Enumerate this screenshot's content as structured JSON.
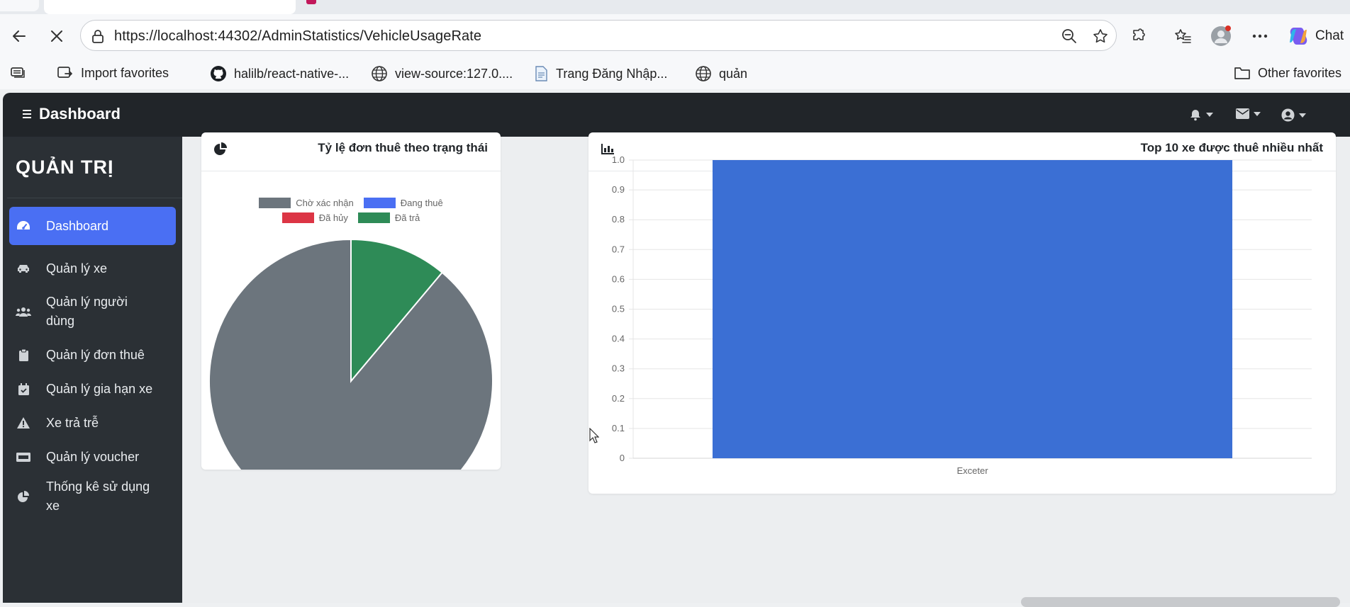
{
  "browser": {
    "url": "https://localhost:44302/AdminStatistics/VehicleUsageRate",
    "copilot_label": "Chat",
    "favorites": [
      {
        "label": "Import favorites",
        "icon": "import-favorites-icon"
      },
      {
        "label": "halilb/react-native-...",
        "icon": "github-icon"
      },
      {
        "label": "view-source:127.0....",
        "icon": "globe-icon"
      },
      {
        "label": "Trang Đăng Nhập...",
        "icon": "page-icon"
      },
      {
        "label": "quản",
        "icon": "globe-icon"
      }
    ],
    "other_favorites": "Other favorites"
  },
  "app": {
    "brand": "Dashboard",
    "sidebar_title": "QUẢN TRỊ",
    "sidebar": [
      {
        "label": "Dashboard",
        "icon": "gauge-icon",
        "active": true
      },
      {
        "label": "Quản lý xe",
        "icon": "car-icon"
      },
      {
        "label": "Quản lý người dùng",
        "icon": "users-icon"
      },
      {
        "label": "Quản lý đơn thuê",
        "icon": "clipboard-icon"
      },
      {
        "label": "Quản lý gia hạn xe",
        "icon": "calendar-check-icon"
      },
      {
        "label": "Xe trả trễ",
        "icon": "warning-icon"
      },
      {
        "label": "Quản lý voucher",
        "icon": "ticket-icon"
      },
      {
        "label": "Thống kê sử dụng xe",
        "icon": "pie-chart-icon"
      }
    ]
  },
  "colors": {
    "pending": "#6c757d",
    "renting": "#4a6ff3",
    "cancelled": "#dc3545",
    "returned": "#2e8b57",
    "bar": "#3b6fd4",
    "topbar": "#212529",
    "sidebar": "#2b3035"
  },
  "chart_data": [
    {
      "type": "pie",
      "title": "Tỷ lệ đơn thuê theo trạng thái",
      "legend_position": "top",
      "series": [
        {
          "name": "Chờ xác nhận",
          "value": 8
        },
        {
          "name": "Đang thuê",
          "value": 0
        },
        {
          "name": "Đã hủy",
          "value": 0
        },
        {
          "name": "Đã trả",
          "value": 1
        }
      ]
    },
    {
      "type": "bar",
      "title": "Top 10 xe được thuê nhiều nhất",
      "categories": [
        "Exceter"
      ],
      "values": [
        1.0
      ],
      "ylim": [
        0,
        1.0
      ],
      "yticks": [
        "0",
        "0.1",
        "0.2",
        "0.3",
        "0.4",
        "0.5",
        "0.6",
        "0.7",
        "0.8",
        "0.9",
        "1.0"
      ],
      "grid": true
    }
  ]
}
